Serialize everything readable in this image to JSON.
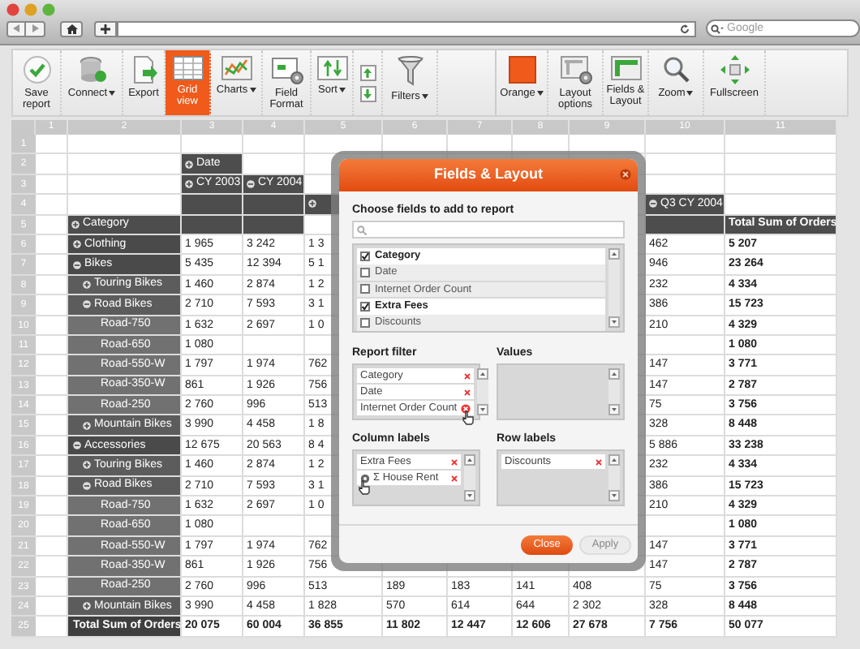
{
  "browser": {
    "search": {
      "placeholder": "Google"
    }
  },
  "toolbar": [
    {
      "kind": "big",
      "label": "Save report",
      "dropdown": false,
      "selected": false
    },
    {
      "kind": "big",
      "label": "Connect",
      "dropdown": true,
      "selected": false
    },
    {
      "kind": "big",
      "label": "Export",
      "dropdown": false,
      "selected": false
    },
    {
      "kind": "big",
      "label": "Grid view",
      "dropdown": false,
      "selected": true
    },
    {
      "kind": "big",
      "label": "Charts",
      "dropdown": true,
      "selected": false
    },
    {
      "kind": "big",
      "label": "Field Format",
      "dropdown": false,
      "selected": false
    },
    {
      "kind": "big",
      "label": "Sort",
      "dropdown": true,
      "selected": false
    },
    {
      "kind": "stack"
    },
    {
      "kind": "big",
      "label": "Filters",
      "dropdown": true,
      "selected": false
    },
    {
      "kind": "spacer"
    },
    {
      "kind": "big",
      "label": "Orange",
      "dropdown": true,
      "selected": false
    },
    {
      "kind": "big",
      "label": "Layout options",
      "dropdown": false,
      "selected": false
    },
    {
      "kind": "big",
      "label": "Fields & Layout",
      "dropdown": false,
      "selected": false
    },
    {
      "kind": "big",
      "label": "Zoom",
      "dropdown": true,
      "selected": false
    },
    {
      "kind": "big",
      "label": "Fullscreen",
      "dropdown": false,
      "selected": false
    }
  ],
  "grid": {
    "column_numbers": [
      "1",
      "2",
      "3",
      "4",
      "5",
      "6",
      "7",
      "8",
      "9",
      "10",
      "11"
    ],
    "row_numbers": [
      "1",
      "2",
      "3",
      "4",
      "5",
      "6",
      "7",
      "8",
      "9",
      "10",
      "11",
      "12",
      "13",
      "14",
      "15",
      "16",
      "17",
      "18",
      "19",
      "20",
      "21",
      "22",
      "23",
      "24",
      "25"
    ],
    "top_rows": {
      "row_2": {
        "col_3": {
          "kind": "header",
          "text": "Date",
          "expanded": false
        }
      },
      "row_3": {
        "col_3": {
          "kind": "header",
          "text": "CY 2003",
          "expanded": false
        },
        "col_4": {
          "kind": "header",
          "text": "CY 2004",
          "expanded": true
        }
      },
      "row_4": {
        "col_3": {
          "kind": "header"
        },
        "col_4": {
          "kind": "header"
        },
        "col_5": {
          "kind": "header",
          "expanded": false
        },
        "col_10": {
          "kind": "header",
          "text": "Q3 CY 2004",
          "expanded": true
        }
      },
      "row_5": {
        "col_2": {
          "kind": "header",
          "text": "Category",
          "expanded": false
        },
        "col_3": {
          "kind": "header"
        },
        "col_4": {
          "kind": "header"
        },
        "col_10": {
          "kind": "header"
        },
        "col_11": {
          "kind": "header",
          "text": "Total Sum of Orders"
        }
      }
    },
    "body": [
      {
        "label": "Clothing",
        "expanded": false,
        "values": {
          "3": "1 965",
          "4": "3 242",
          "5": "1 3",
          "10": "462",
          "11": "5 207"
        }
      },
      {
        "label": "Bikes",
        "expanded": true,
        "values": {
          "3": "5 435",
          "4": "12 394",
          "5": "5 1",
          "10": "946",
          "11": "23 264"
        },
        "children": [
          {
            "label": "Touring Bikes",
            "expanded": false,
            "values": {
              "3": "1 460",
              "4": "2 874",
              "5": "1 2",
              "10": "232",
              "11": "4 334"
            }
          },
          {
            "label": "Road Bikes",
            "expanded": true,
            "values": {
              "3": "2 710",
              "4": "7 593",
              "5": "3 1",
              "10": "386",
              "11": "15 723"
            },
            "children": [
              {
                "label": "Road-750",
                "values": {
                  "3": "1 632",
                  "4": "2 697",
                  "5": "1 0",
                  "10": "210",
                  "11": "4 329"
                }
              },
              {
                "label": "Road-650",
                "values": {
                  "3": "1 080",
                  "11": "1 080"
                }
              },
              {
                "label": "Road-550-W",
                "values": {
                  "3": "1 797",
                  "4": "1 974",
                  "5": "762",
                  "10": "147",
                  "11": "3 771"
                }
              },
              {
                "label": "Road-350-W",
                "values": {
                  "3": "861",
                  "4": "1 926",
                  "5": "756",
                  "10": "147",
                  "11": "2 787"
                }
              },
              {
                "label": "Road-250",
                "values": {
                  "3": "2 760",
                  "4": "996",
                  "5": "513",
                  "10": "75",
                  "11": "3 756"
                }
              }
            ]
          },
          {
            "label": "Mountain Bikes",
            "expanded": false,
            "values": {
              "3": "3 990",
              "4": "4 458",
              "5": "1 8",
              "10": "328",
              "11": "8 448"
            }
          }
        ]
      },
      {
        "label": "Accessories",
        "expanded": true,
        "values": {
          "3": "12 675",
          "4": "20 563",
          "5": "8 4",
          "10": "5 886",
          "11": "33 238"
        },
        "children": [
          {
            "label": "Touring Bikes",
            "expanded": false,
            "values": {
              "3": "1 460",
              "4": "2 874",
              "5": "1 2",
              "10": "232",
              "11": "4 334"
            }
          },
          {
            "label": "Road Bikes",
            "expanded": true,
            "values": {
              "3": "2 710",
              "4": "7 593",
              "5": "3 1",
              "10": "386",
              "11": "15 723"
            },
            "children": [
              {
                "label": "Road-750",
                "values": {
                  "3": "1 632",
                  "4": "2 697",
                  "5": "1 0",
                  "10": "210",
                  "11": "4 329"
                }
              },
              {
                "label": "Road-650",
                "values": {
                  "3": "1 080",
                  "11": "1 080"
                }
              },
              {
                "label": "Road-550-W",
                "values": {
                  "3": "1 797",
                  "4": "1 974",
                  "5": "762",
                  "10": "147",
                  "11": "3 771"
                }
              },
              {
                "label": "Road-350-W",
                "values": {
                  "3": "861",
                  "4": "1 926",
                  "5": "756",
                  "10": "147",
                  "11": "2 787"
                }
              },
              {
                "label": "Road-250",
                "values": {
                  "3": "2 760",
                  "4": "996",
                  "5": "513",
                  "6": "189",
                  "7": "183",
                  "8": "141",
                  "9": "408",
                  "10": "75",
                  "11": "3 756"
                }
              }
            ]
          },
          {
            "label": "Mountain Bikes",
            "expanded": false,
            "values": {
              "3": "3 990",
              "4": "4 458",
              "5": "1 828",
              "6": "570",
              "7": "614",
              "8": "644",
              "9": "2 302",
              "10": "328",
              "11": "8 448"
            }
          }
        ]
      }
    ],
    "total": {
      "label": "Total Sum of Orders",
      "values": {
        "3": "20 075",
        "4": "60 004",
        "5": "36 855",
        "6": "11 802",
        "7": "12 447",
        "8": "12 606",
        "9": "27 678",
        "10": "7 756",
        "11": "50 077"
      }
    }
  },
  "dialog": {
    "title": "Fields & Layout",
    "fields_heading": "Choose fields to add to report",
    "fields": [
      {
        "label": "Category",
        "checked": true
      },
      {
        "label": "Date",
        "checked": false
      },
      {
        "label": "Internet Order Count",
        "checked": false
      },
      {
        "label": "Extra Fees",
        "checked": true
      },
      {
        "label": "Discounts",
        "checked": false
      }
    ],
    "areas": [
      {
        "title": "Report filter",
        "items": [
          {
            "label": "Category",
            "hovered": false,
            "dragging": false
          },
          {
            "label": "Date",
            "hovered": false,
            "dragging": false
          },
          {
            "label": "Internet Order Count",
            "hovered": true,
            "dragging": false
          }
        ]
      },
      {
        "title": "Values"
      },
      {
        "title": "Column labels",
        "items": [
          {
            "label": "Extra Fees",
            "hovered": false,
            "dragging": false
          },
          {
            "label": "Σ House Rent",
            "hovered": false,
            "dragging": true
          }
        ]
      },
      {
        "title": "Row labels",
        "items": [
          {
            "label": "Discounts",
            "hovered": false,
            "dragging": false
          }
        ]
      }
    ],
    "buttons": [
      {
        "label": "Close",
        "disabled": false
      },
      {
        "label": "Apply",
        "disabled": true
      }
    ]
  }
}
